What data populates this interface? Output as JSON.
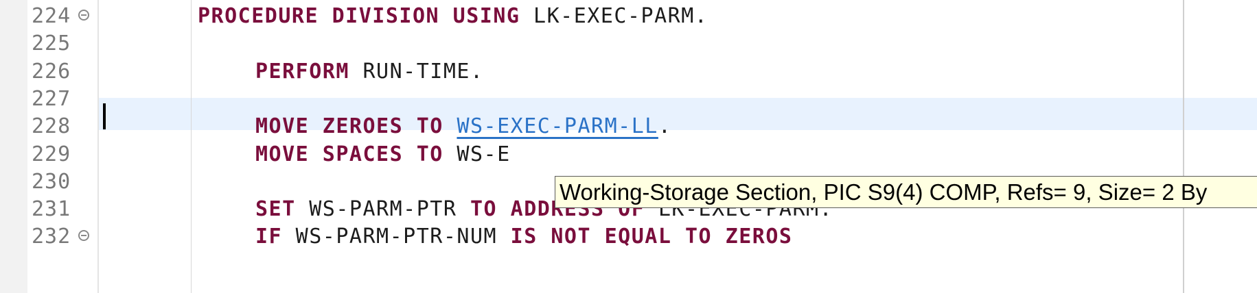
{
  "editor": {
    "lines": [
      {
        "num": "224",
        "fold": true,
        "indent": 0,
        "tokens": [
          {
            "t": "PROCEDURE DIVISION USING",
            "c": "kw"
          },
          {
            "t": " ",
            "c": "id"
          },
          {
            "t": "LK-EXEC-PARM.",
            "c": "id"
          }
        ]
      },
      {
        "num": "225",
        "fold": false,
        "indent": 0,
        "tokens": []
      },
      {
        "num": "226",
        "fold": false,
        "indent": 1,
        "tokens": [
          {
            "t": "PERFORM",
            "c": "kw"
          },
          {
            "t": " RUN-TIME.",
            "c": "id"
          }
        ]
      },
      {
        "num": "227",
        "fold": false,
        "indent": 0,
        "tokens": [],
        "current": true
      },
      {
        "num": "228",
        "fold": false,
        "indent": 1,
        "tokens": [
          {
            "t": "MOVE ZEROES TO",
            "c": "kw"
          },
          {
            "t": " ",
            "c": "id"
          },
          {
            "t": "WS-EXEC-PARM-LL",
            "c": "link"
          },
          {
            "t": ".",
            "c": "id"
          }
        ]
      },
      {
        "num": "229",
        "fold": false,
        "indent": 1,
        "tokens": [
          {
            "t": "MOVE SPACES TO",
            "c": "kw"
          },
          {
            "t": " WS-E",
            "c": "id"
          }
        ]
      },
      {
        "num": "230",
        "fold": false,
        "indent": 0,
        "tokens": []
      },
      {
        "num": "231",
        "fold": false,
        "indent": 1,
        "tokens": [
          {
            "t": "SET",
            "c": "kw"
          },
          {
            "t": " WS-PARM-PTR ",
            "c": "id"
          },
          {
            "t": "TO ADDRESS OF",
            "c": "kw"
          },
          {
            "t": " LK-EXEC-PARM.",
            "c": "id"
          }
        ]
      },
      {
        "num": "232",
        "fold": true,
        "indent": 1,
        "tokens": [
          {
            "t": "IF",
            "c": "kw"
          },
          {
            "t": " WS-PARM-PTR-NUM ",
            "c": "id"
          },
          {
            "t": "IS NOT EQUAL TO ZEROS",
            "c": "kw"
          }
        ]
      }
    ]
  },
  "tooltip": {
    "text": "Working-Storage Section, PIC S9(4) COMP, Refs= 9, Size= 2 By"
  },
  "colors": {
    "keyword": "#7a0e3c",
    "identifier": "#1c1c1c",
    "link": "#2a72c7",
    "current_line": "#e8f2fe",
    "tooltip_bg": "#ffffe1"
  }
}
